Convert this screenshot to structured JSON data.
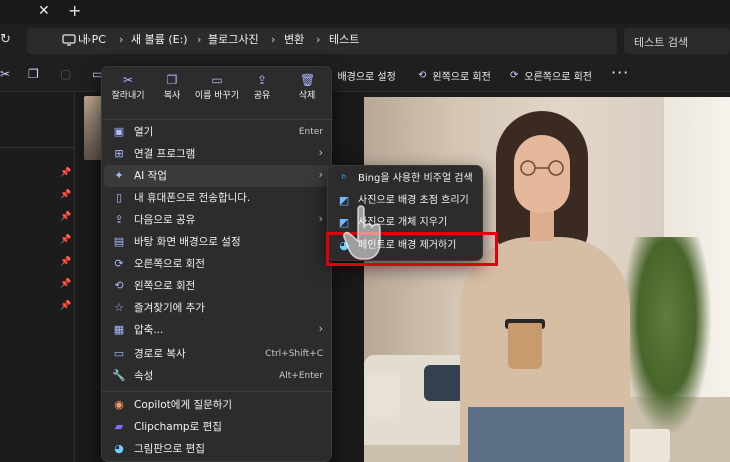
{
  "titlebar": {
    "close_glyph": "✕",
    "new_tab_glyph": "+"
  },
  "address": {
    "crumbs": [
      "내 PC",
      "새 볼륨 (E:)",
      "블로그사진",
      "변환",
      "테스트"
    ],
    "search_placeholder": "테스트 검색"
  },
  "toolbar": {
    "set_background": "배경으로 설정",
    "rotate_left": "왼쪽으로 회전",
    "rotate_right": "오른쪽으로 회전",
    "more": "···"
  },
  "context_menu": {
    "quick_actions": [
      {
        "label": "잘라내기",
        "icon": "scissors-icon"
      },
      {
        "label": "복사",
        "icon": "copy-icon"
      },
      {
        "label": "이름 바꾸기",
        "icon": "rename-icon"
      },
      {
        "label": "공유",
        "icon": "share-icon"
      },
      {
        "label": "삭제",
        "icon": "trash-icon"
      }
    ],
    "items": [
      {
        "label": "열기",
        "accel": "Enter",
        "icon": "open-icon"
      },
      {
        "label": "연결 프로그램",
        "icon": "open-with-icon",
        "submenu": true
      },
      {
        "label": "AI 작업",
        "icon": "ai-sparkle-icon",
        "submenu": true
      },
      {
        "label": "내 휴대폰으로 전송합니다.",
        "icon": "phone-icon"
      },
      {
        "label": "다음으로 공유",
        "icon": "share-icon",
        "submenu": true
      },
      {
        "label": "바탕 화면 배경으로 설정",
        "icon": "wallpaper-icon"
      },
      {
        "label": "오른쪽으로 회전",
        "icon": "rotate-right-icon"
      },
      {
        "label": "왼쪽으로 회전",
        "icon": "rotate-left-icon"
      },
      {
        "label": "즐겨찾기에 추가",
        "icon": "star-icon"
      },
      {
        "label": "압축...",
        "icon": "zip-icon",
        "submenu": true
      },
      {
        "label": "경로로 복사",
        "accel": "Ctrl+Shift+C",
        "icon": "copy-path-icon"
      },
      {
        "label": "속성",
        "accel": "Alt+Enter",
        "icon": "wrench-icon"
      },
      {
        "label": "Copilot에게 질문하기",
        "icon": "copilot-icon"
      },
      {
        "label": "Clipchamp로 편집",
        "icon": "clipchamp-icon"
      },
      {
        "label": "그림판으로 편집",
        "icon": "paint-icon"
      }
    ]
  },
  "ai_submenu": {
    "items": [
      {
        "label": "Bing을 사용한 비주얼 검색",
        "icon": "bing-icon"
      },
      {
        "label": "사진으로 배경 초점 흐리기",
        "icon": "photos-icon"
      },
      {
        "label": "사진으로 개체 지우기",
        "icon": "photos-icon"
      },
      {
        "label": "페인트로 배경 제거하기",
        "icon": "paint-icon"
      }
    ]
  },
  "colors": {
    "highlight": "#e0000a",
    "menu_bg": "#2c2c2c",
    "accent_icon": "#a9b9ff"
  }
}
